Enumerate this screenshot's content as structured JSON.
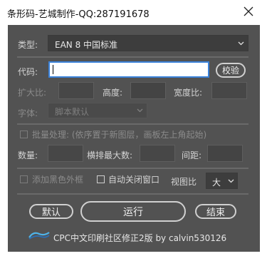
{
  "window": {
    "title": "条形码-艺城制作-QQ:287191678"
  },
  "type_row": {
    "label": "类型:",
    "selected": "EAN 8 中国标准"
  },
  "code_row": {
    "label": "代码:",
    "value": "",
    "verify_button": "校验"
  },
  "size_row": {
    "scale_label": "扩大比:",
    "height_label": "高度:",
    "width_ratio_label": "宽度比:"
  },
  "font_row": {
    "label": "字体:",
    "selected": "脚本默认"
  },
  "batch": {
    "label": "批量处理: (依序置于新图层，画板左上角起始)"
  },
  "layout_row": {
    "count_label": "数量:",
    "max_row_label": "横排最大数:",
    "spacing_label": "间距:"
  },
  "options": {
    "black_border_label": "添加黑色外框",
    "auto_close_label": "自动关闭窗口",
    "view_ratio_label": "视图比",
    "view_ratio_value": "大"
  },
  "buttons": {
    "default": "默认",
    "run": "运行",
    "end": "结束"
  },
  "footer": {
    "logo_text": "CPC",
    "credit": "CPC中文印刷社区修正2版 by calvin530126"
  }
}
